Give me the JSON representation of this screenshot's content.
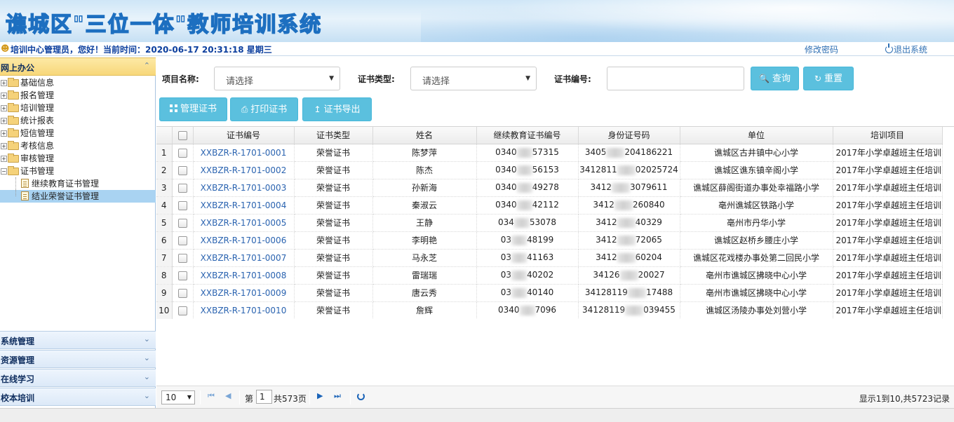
{
  "app": {
    "title": "谯城区\"三位一体\"教师培训系统"
  },
  "infobar": {
    "greeting": "培训中心管理员，您好！当前时间：2020-06-17 20:31:18 星期三",
    "change_password": "修改密码",
    "logout": "退出系统"
  },
  "sidebar": {
    "active_section": "网上办公",
    "tree": [
      {
        "label": "基础信息"
      },
      {
        "label": "报名管理"
      },
      {
        "label": "培训管理"
      },
      {
        "label": "统计报表"
      },
      {
        "label": "短信管理"
      },
      {
        "label": "考核信息"
      },
      {
        "label": "审核管理"
      },
      {
        "label": "证书管理"
      }
    ],
    "children": [
      {
        "label": "继续教育证书管理"
      },
      {
        "label": "结业荣誉证书管理"
      }
    ],
    "sections": [
      {
        "label": "系统管理"
      },
      {
        "label": "资源管理"
      },
      {
        "label": "在线学习"
      },
      {
        "label": "校本培训"
      }
    ]
  },
  "filters": {
    "project_label": "项目名称:",
    "project_placeholder": "请选择",
    "cert_type_label": "证书类型:",
    "cert_type_placeholder": "请选择",
    "cert_no_label": "证书编号:",
    "cert_no_value": "",
    "search_label": "查询",
    "reset_label": "重置"
  },
  "toolbar": {
    "manage_label": "管理证书",
    "print_label": "打印证书",
    "export_label": "证书导出"
  },
  "table": {
    "headers": [
      "证书编号",
      "证书类型",
      "姓名",
      "继续教育证书编号",
      "身份证号码",
      "单位",
      "培训项目"
    ],
    "rows": [
      {
        "num": "1",
        "code": "XXBZR-R-1701-0001",
        "type": "荣誉证书",
        "name": "陈梦萍",
        "cont_a": "0340",
        "cont_b": "57315",
        "id_a": "3405",
        "id_b": "204186221",
        "unit": "谯城区古井镇中心小学",
        "project": "2017年小学卓越班主任培训"
      },
      {
        "num": "2",
        "code": "XXBZR-R-1701-0002",
        "type": "荣誉证书",
        "name": "陈杰",
        "cont_a": "0340",
        "cont_b": "56153",
        "id_a": "3412811",
        "id_b": "02025724",
        "unit": "谯城区谯东镇辛阁小学",
        "project": "2017年小学卓越班主任培训"
      },
      {
        "num": "3",
        "code": "XXBZR-R-1701-0003",
        "type": "荣誉证书",
        "name": "孙新海",
        "cont_a": "0340",
        "cont_b": "49278",
        "id_a": "3412",
        "id_b": "3079611",
        "unit": "谯城区薛阁街道办事处幸福路小学",
        "project": "2017年小学卓越班主任培训"
      },
      {
        "num": "4",
        "code": "XXBZR-R-1701-0004",
        "type": "荣誉证书",
        "name": "秦淑云",
        "cont_a": "0340",
        "cont_b": "42112",
        "id_a": "3412",
        "id_b": "260840",
        "unit": "亳州谯城区铁路小学",
        "project": "2017年小学卓越班主任培训"
      },
      {
        "num": "5",
        "code": "XXBZR-R-1701-0005",
        "type": "荣誉证书",
        "name": "王静",
        "cont_a": "034",
        "cont_b": "53078",
        "id_a": "3412",
        "id_b": "40329",
        "unit": "亳州市丹华小学",
        "project": "2017年小学卓越班主任培训"
      },
      {
        "num": "6",
        "code": "XXBZR-R-1701-0006",
        "type": "荣誉证书",
        "name": "李明艳",
        "cont_a": "03",
        "cont_b": "48199",
        "id_a": "3412",
        "id_b": "72065",
        "unit": "谯城区赵桥乡腰庄小学",
        "project": "2017年小学卓越班主任培训"
      },
      {
        "num": "7",
        "code": "XXBZR-R-1701-0007",
        "type": "荣誉证书",
        "name": "马永芝",
        "cont_a": "03",
        "cont_b": "41163",
        "id_a": "3412",
        "id_b": "60204",
        "unit": "谯城区花戏楼办事处第二回民小学",
        "project": "2017年小学卓越班主任培训"
      },
      {
        "num": "8",
        "code": "XXBZR-R-1701-0008",
        "type": "荣誉证书",
        "name": "雷瑞瑞",
        "cont_a": "03",
        "cont_b": "40202",
        "id_a": "34126",
        "id_b": "20027",
        "unit": "亳州市谯城区拂晓中心小学",
        "project": "2017年小学卓越班主任培训"
      },
      {
        "num": "9",
        "code": "XXBZR-R-1701-0009",
        "type": "荣誉证书",
        "name": "唐云秀",
        "cont_a": "03",
        "cont_b": "40140",
        "id_a": "34128119",
        "id_b": "17488",
        "unit": "亳州市谯城区拂晓中心小学",
        "project": "2017年小学卓越班主任培训"
      },
      {
        "num": "10",
        "code": "XXBZR-R-1701-0010",
        "type": "荣誉证书",
        "name": "詹辉",
        "cont_a": "0340",
        "cont_b": "7096",
        "id_a": "34128119",
        "id_b": "039455",
        "unit": "谯城区汤陵办事处刘营小学",
        "project": "2017年小学卓越班主任培训"
      }
    ]
  },
  "pager": {
    "page_size": "10",
    "page_prefix": "第",
    "page_current": "1",
    "page_total": "共573页",
    "summary": "显示1到10,共5723记录"
  }
}
